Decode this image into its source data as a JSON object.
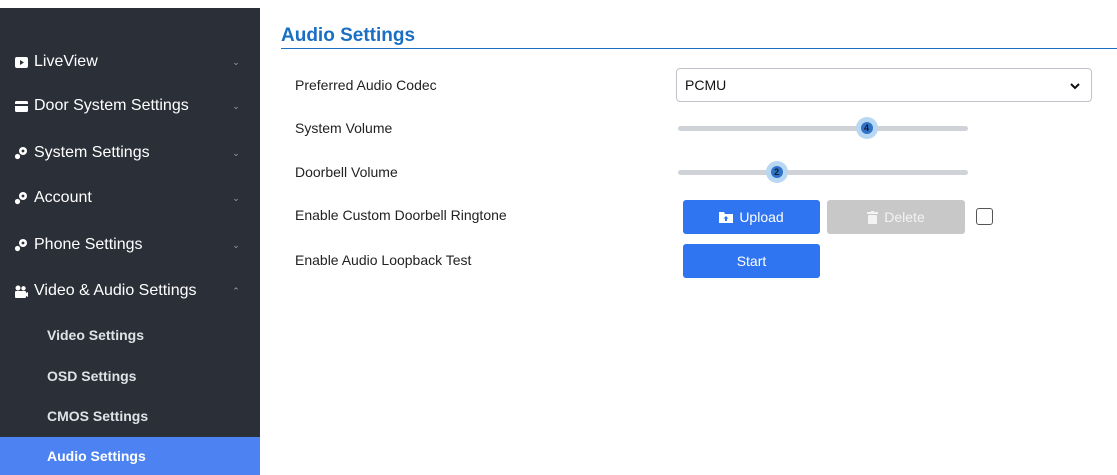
{
  "sidebar": {
    "items": [
      {
        "label": "LiveView",
        "icon": "tv-icon",
        "chevron": "⌄"
      },
      {
        "label": "Door System Settings",
        "icon": "door-system-icon",
        "chevron": "⌄"
      },
      {
        "label": "System Settings",
        "icon": "wrench-icon",
        "chevron": "⌄"
      },
      {
        "label": "Account",
        "icon": "wrench-icon",
        "chevron": "⌄"
      },
      {
        "label": "Phone Settings",
        "icon": "wrench-icon",
        "chevron": "⌄"
      },
      {
        "label": "Video & Audio Settings",
        "icon": "video-audio-icon",
        "chevron": "⌃"
      }
    ],
    "subitems": [
      {
        "label": "Video Settings"
      },
      {
        "label": "OSD Settings"
      },
      {
        "label": "CMOS Settings"
      },
      {
        "label": "Audio Settings",
        "active": true
      }
    ]
  },
  "main": {
    "title": "Audio Settings",
    "rows": {
      "codec": {
        "label": "Preferred Audio Codec",
        "value": "PCMU"
      },
      "system_volume": {
        "label": "System Volume",
        "value": "4",
        "level": 0.65
      },
      "doorbell_volume": {
        "label": "Doorbell Volume",
        "value": "2",
        "level": 0.34
      },
      "ringtone": {
        "label": "Enable Custom Doorbell Ringtone",
        "upload_label": "Upload",
        "delete_label": "Delete",
        "checked": false
      },
      "loopback": {
        "label": "Enable Audio Loopback Test",
        "start_label": "Start"
      }
    }
  },
  "colors": {
    "sidebar_bg": "#2b2f37",
    "active_item": "#4d82f2",
    "title": "#1a6fc4",
    "primary_button": "#2f74f0",
    "disabled_button": "#c8c8c8"
  }
}
